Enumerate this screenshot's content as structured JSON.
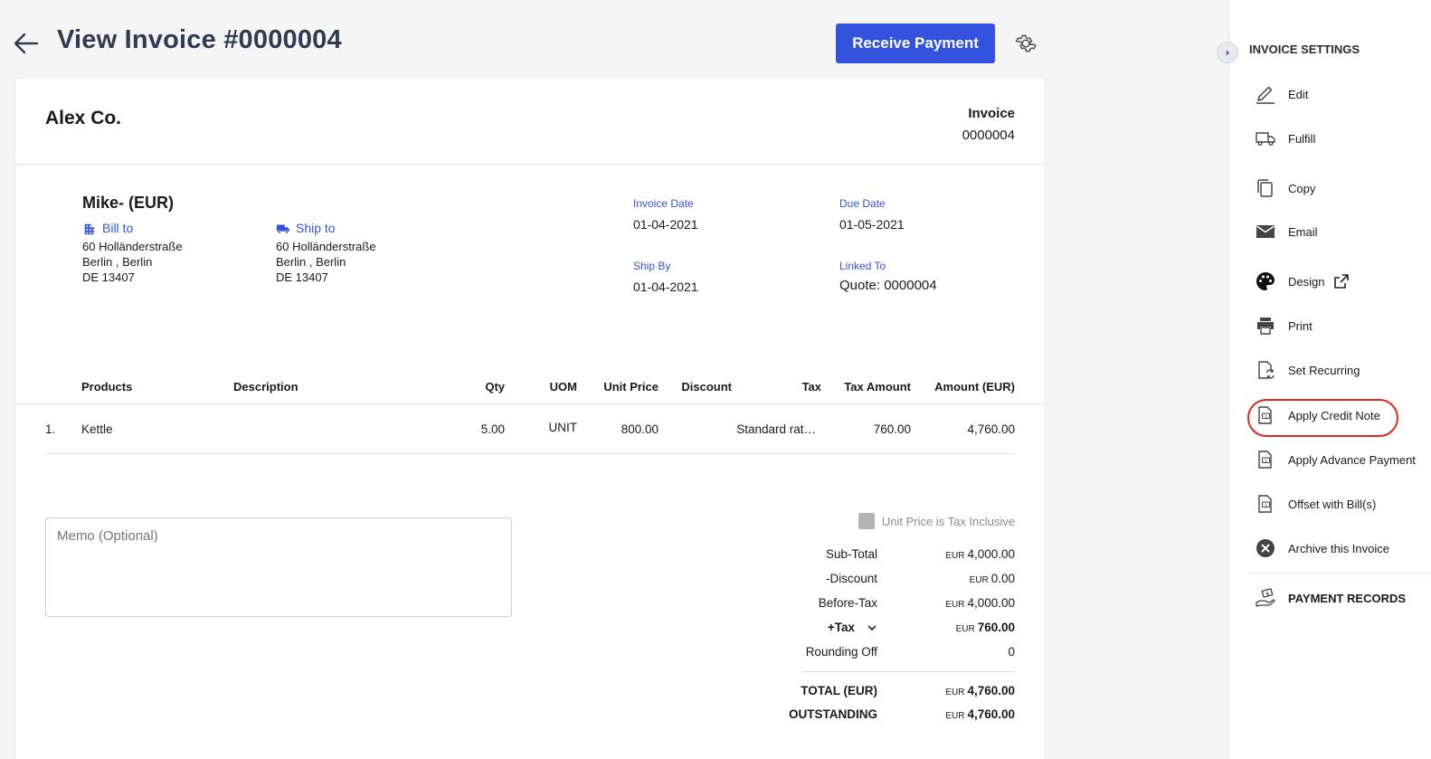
{
  "header": {
    "title": "View Invoice #0000004",
    "receive_payment": "Receive Payment"
  },
  "invoice": {
    "company": "Alex Co.",
    "label": "Invoice",
    "number": "0000004",
    "customer": "Mike- (EUR)",
    "bill_to": {
      "label": "Bill to",
      "lines": [
        "60 Holländerstraße",
        "Berlin , Berlin",
        "DE 13407"
      ]
    },
    "ship_to": {
      "label": "Ship to",
      "lines": [
        "60 Holländerstraße",
        "Berlin , Berlin",
        "DE 13407"
      ]
    },
    "invoice_date": {
      "label": "Invoice Date",
      "value": "01-04-2021"
    },
    "due_date": {
      "label": "Due Date",
      "value": "01-05-2021"
    },
    "ship_by": {
      "label": "Ship By",
      "value": "01-04-2021"
    },
    "linked_to": {
      "label": "Linked To",
      "value": "Quote: 0000004"
    }
  },
  "table": {
    "headers": {
      "products": "Products",
      "description": "Description",
      "qty": "Qty",
      "uom": "UOM",
      "unit_price": "Unit Price",
      "discount": "Discount",
      "tax": "Tax",
      "tax_amount": "Tax Amount",
      "amount": "Amount (EUR)"
    },
    "rows": [
      {
        "index": "1.",
        "product": "Kettle",
        "description": "",
        "qty": "5.00",
        "uom": "UNIT",
        "unit_price": "800.00",
        "discount": "",
        "tax": "Standard rat…",
        "tax_amount": "760.00",
        "amount": "4,760.00"
      }
    ]
  },
  "memo": {
    "placeholder": "Memo (Optional)"
  },
  "tax_inclusive_label": "Unit Price is Tax Inclusive",
  "totals": {
    "subtotal": {
      "label": "Sub-Total",
      "currency": "EUR",
      "value": "4,000.00"
    },
    "discount": {
      "label": "-Discount",
      "currency": "EUR",
      "value": "0.00"
    },
    "before_tax": {
      "label": "Before-Tax",
      "currency": "EUR",
      "value": "4,000.00"
    },
    "tax": {
      "label": "+Tax",
      "currency": "EUR",
      "value": "760.00"
    },
    "rounding": {
      "label": "Rounding Off",
      "value": "0"
    },
    "total": {
      "label": "TOTAL (EUR)",
      "currency": "EUR",
      "value": "4,760.00"
    },
    "outstanding": {
      "label": "OUTSTANDING",
      "currency": "EUR",
      "value": "4,760.00"
    }
  },
  "settings_panel": {
    "title": "INVOICE SETTINGS",
    "items": {
      "edit": "Edit",
      "fulfill": "Fulfill",
      "copy": "Copy",
      "email": "Email",
      "design": "Design",
      "print": "Print",
      "set_recurring": "Set Recurring",
      "apply_credit_note": "Apply Credit Note",
      "apply_advance_payment": "Apply Advance Payment",
      "offset_with_bills": "Offset with Bill(s)",
      "archive": "Archive this Invoice",
      "payment_records": "PAYMENT RECORDS"
    },
    "highlighted_item": "Apply Credit Note",
    "highlight_color": "#e2271b"
  },
  "colors": {
    "accent": "#3352dd",
    "title": "#2f3b52"
  }
}
